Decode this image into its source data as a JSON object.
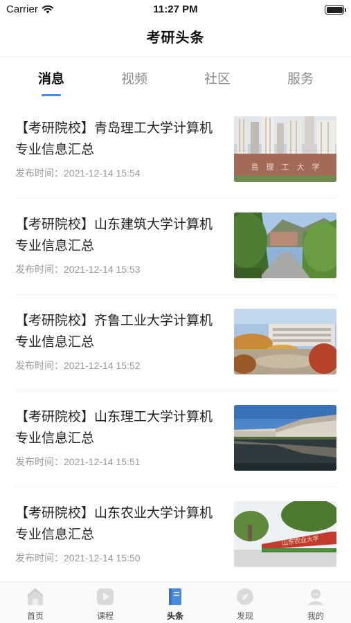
{
  "status_bar": {
    "carrier": "Carrier",
    "time": "11:27 PM",
    "wifi_icon": "wifi-icon",
    "battery_icon": "battery-icon"
  },
  "nav": {
    "title": "考研头条"
  },
  "tabs": [
    {
      "label": "消息",
      "active": true
    },
    {
      "label": "视频",
      "active": false
    },
    {
      "label": "社区",
      "active": false
    },
    {
      "label": "服务",
      "active": false
    }
  ],
  "accent_color": "#4a8bdc",
  "news": [
    {
      "title": "【考研院校】青岛理工大学计算机专业信息汇总",
      "time": "发布时间：2021-12-14 15:54"
    },
    {
      "title": "【考研院校】山东建筑大学计算机专业信息汇总",
      "time": "发布时间：2021-12-14 15:53"
    },
    {
      "title": "【考研院校】齐鲁工业大学计算机专业信息汇总",
      "time": "发布时间：2021-12-14 15:52"
    },
    {
      "title": "【考研院校】山东理工大学计算机专业信息汇总",
      "time": "发布时间：2021-12-14 15:51"
    },
    {
      "title": "【考研院校】山东农业大学计算机专业信息汇总",
      "time": "发布时间：2021-12-14 15:50"
    }
  ],
  "tab_bar": [
    {
      "label": "首页",
      "icon": "home-icon",
      "active": false
    },
    {
      "label": "课程",
      "icon": "play-icon",
      "active": false
    },
    {
      "label": "头条",
      "icon": "book-icon",
      "active": true
    },
    {
      "label": "发现",
      "icon": "compass-icon",
      "active": false
    },
    {
      "label": "我的",
      "icon": "profile-icon",
      "active": false
    }
  ],
  "thumb_text": [
    "島　理　工　大　学",
    "山东农业大学"
  ]
}
